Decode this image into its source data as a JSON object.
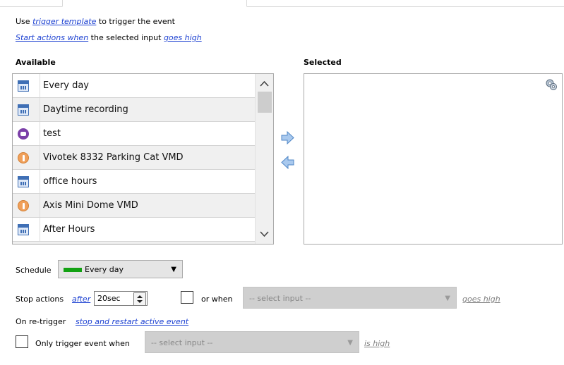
{
  "trigger_line": {
    "prefix": "Use",
    "link": "trigger template",
    "suffix": "to trigger the event"
  },
  "start_line": {
    "link1": "Start actions when",
    "middle": "the selected input",
    "link2": "goes high"
  },
  "available": {
    "header": "Available",
    "items": [
      {
        "label": "Every day",
        "icon": "calendar-icon"
      },
      {
        "label": "Daytime recording",
        "icon": "calendar-icon"
      },
      {
        "label": "test",
        "icon": "pointing-hand-icon"
      },
      {
        "label": "Vivotek 8332 Parking Cat VMD",
        "icon": "motion-person-icon"
      },
      {
        "label": "office hours",
        "icon": "calendar-icon"
      },
      {
        "label": "Axis Mini Dome VMD",
        "icon": "motion-person-icon"
      },
      {
        "label": "After Hours",
        "icon": "calendar-icon"
      }
    ]
  },
  "selected": {
    "header": "Selected",
    "icon": "settings-gear-icon"
  },
  "schedule": {
    "label": "Schedule",
    "value": "Every day",
    "swatch_color": "#12a112"
  },
  "stop_actions": {
    "label": "Stop actions",
    "link": "after",
    "duration": "20sec",
    "or_when": "or when",
    "select_placeholder": "-- select input --",
    "condition": "goes high"
  },
  "retrigger": {
    "label": "On re-trigger",
    "link": "stop and restart active event"
  },
  "only_trigger": {
    "label": "Only trigger event when",
    "select_placeholder": "-- select input --",
    "condition": "is high"
  },
  "colors": {
    "link": "#1a3fd1",
    "arrow": "#6fa4dc"
  }
}
